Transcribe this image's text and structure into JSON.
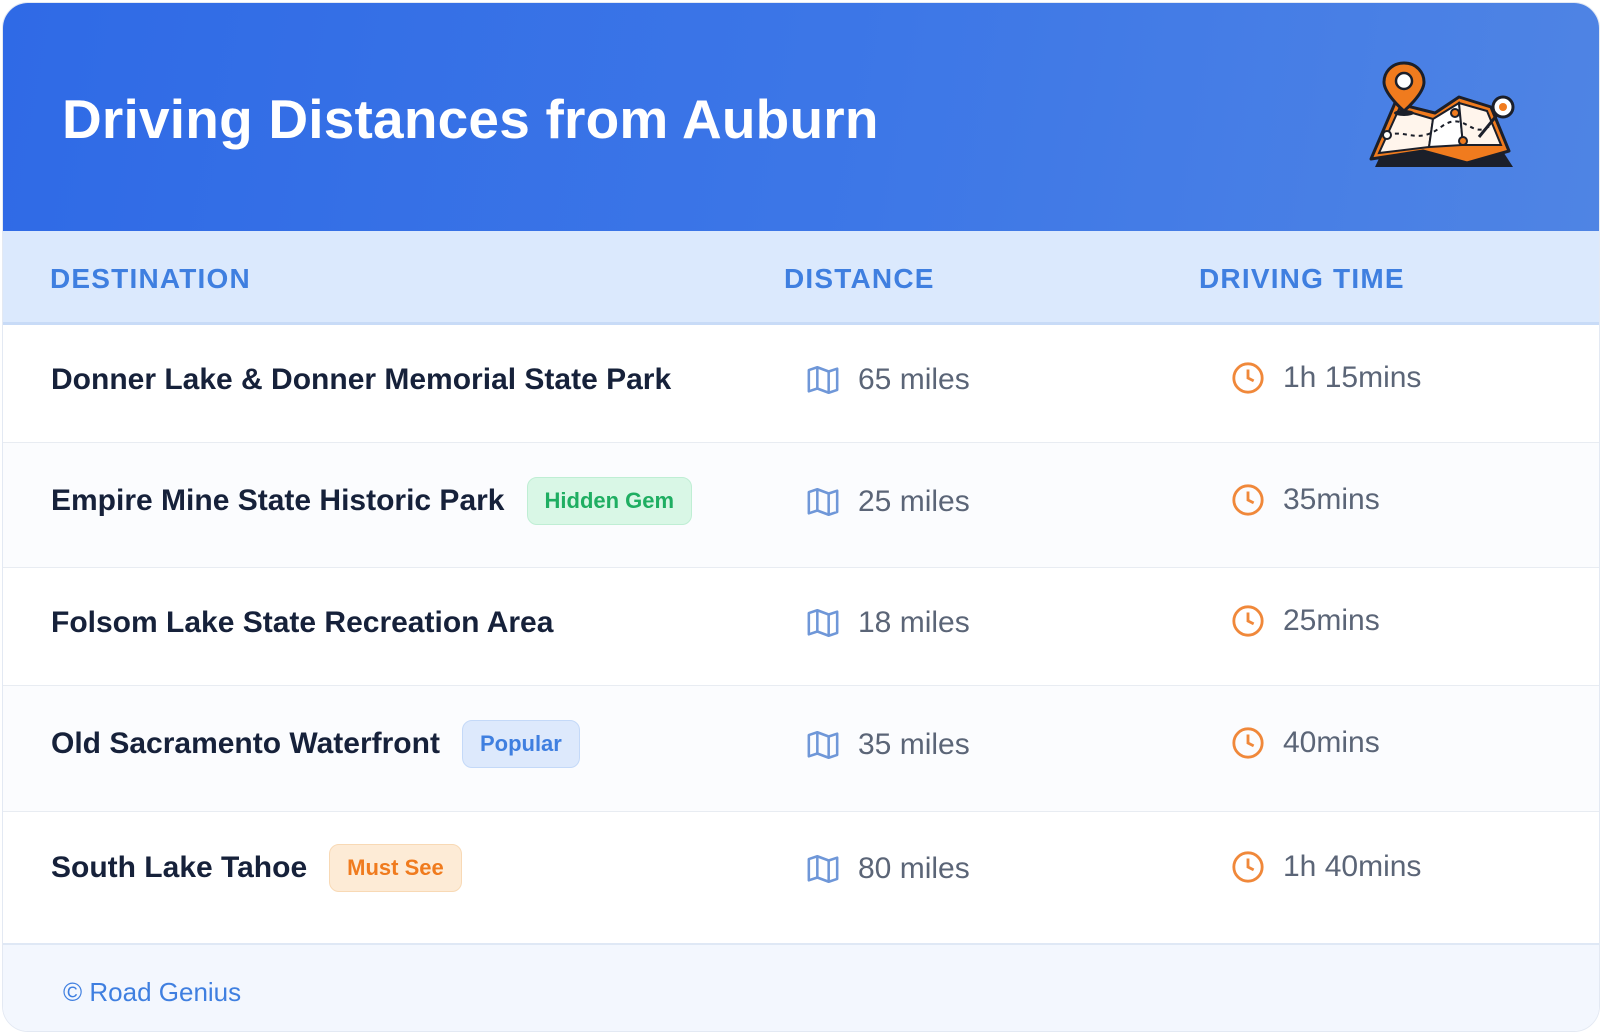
{
  "header": {
    "title": "Driving Distances from Auburn",
    "illustration_icon": "folded-map-with-pin-icon"
  },
  "table": {
    "columns": [
      "DESTINATION",
      "DISTANCE",
      "DRIVING TIME"
    ],
    "rows": [
      {
        "destination": "Donner Lake & Donner Memorial State Park",
        "badge": "",
        "distance": "65 miles",
        "time": "1h 15mins"
      },
      {
        "destination": "Empire Mine State Historic Park",
        "badge": "Hidden Gem",
        "distance": "25 miles",
        "time": "35mins"
      },
      {
        "destination": "Folsom Lake State Recreation Area",
        "badge": "",
        "distance": "18 miles",
        "time": "25mins"
      },
      {
        "destination": "Old Sacramento Waterfront",
        "badge": "Popular",
        "distance": "35 miles",
        "time": "40mins"
      },
      {
        "destination": "South Lake Tahoe",
        "badge": "Must See",
        "distance": "80 miles",
        "time": "1h 40mins"
      }
    ]
  },
  "footer": {
    "text": "© Road Genius"
  },
  "colors": {
    "header_gradient_start": "#2f6ae6",
    "header_gradient_end": "#4f84e4",
    "accent_blue": "#3f7fe0",
    "accent_orange": "#f07b1e",
    "badge_green": "#1fae62",
    "text_dark": "#16213a",
    "text_muted": "#5b6577"
  },
  "icons": {
    "distance": "map-icon",
    "time": "clock-icon"
  }
}
